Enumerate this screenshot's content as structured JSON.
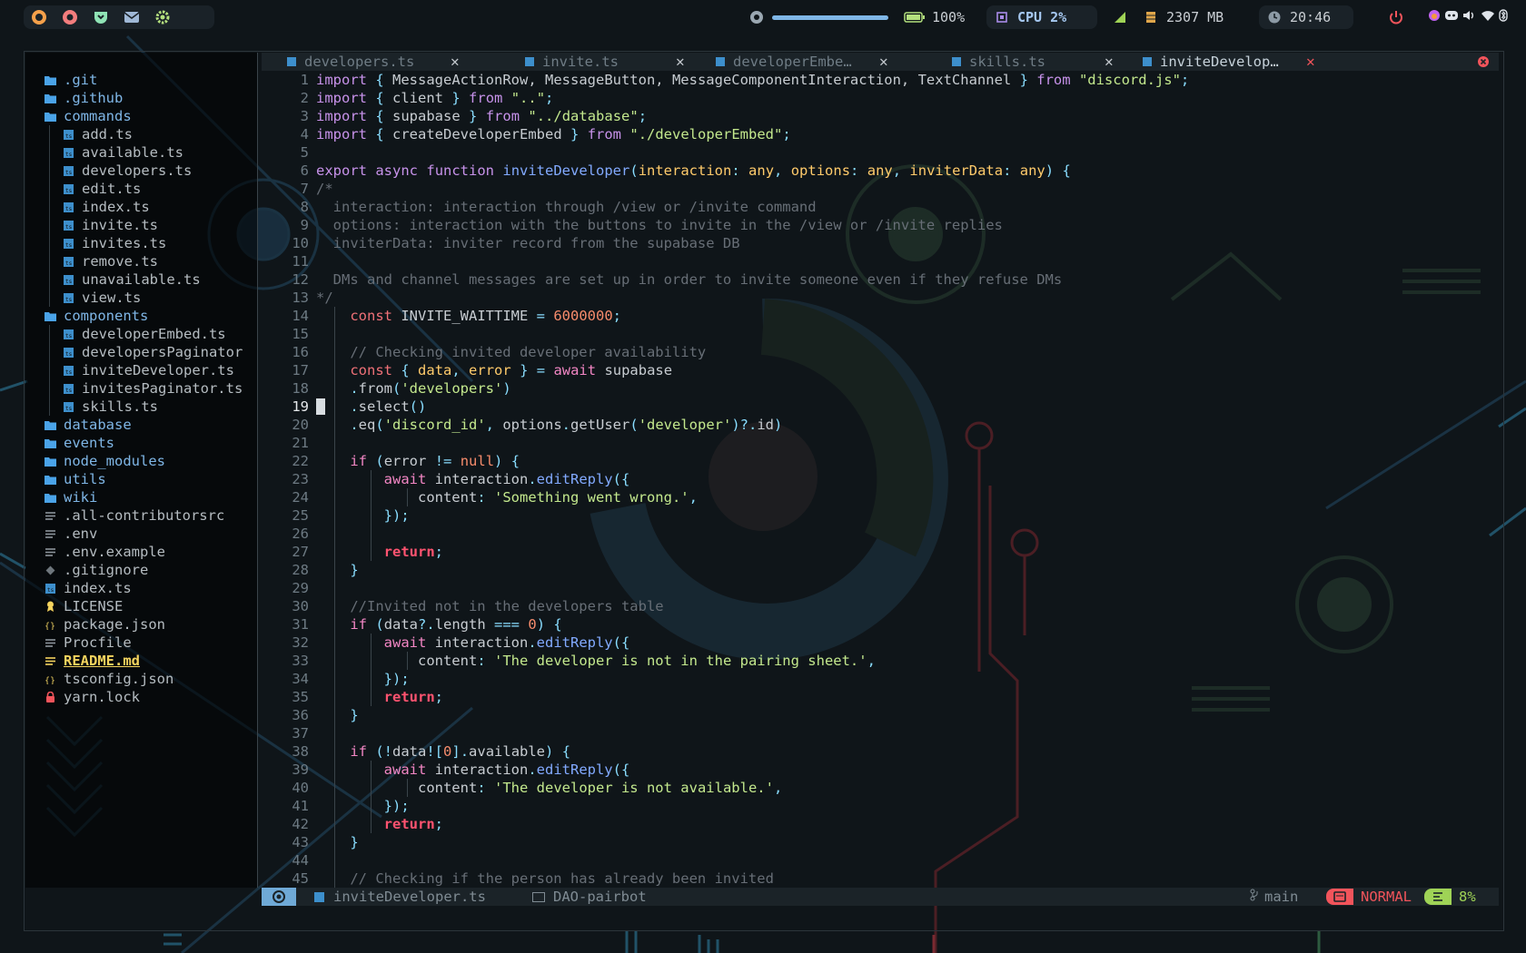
{
  "topbar": {
    "volume": "100%",
    "battery": "100%",
    "cpu": "CPU 2%",
    "memory": "2307 MB",
    "clock": "20:46",
    "volume_level": 1.0,
    "app_icons": [
      "firefox-icon",
      "chrome-icon",
      "pocket-icon",
      "mail-icon",
      "settings-icon"
    ],
    "tray_icons": [
      "power-icon",
      "flame-icon",
      "discord-icon",
      "speaker-icon",
      "wifi-icon",
      "bluetooth-icon"
    ]
  },
  "sidebar": {
    "items": [
      {
        "label": ".git",
        "type": "folder",
        "depth": 0
      },
      {
        "label": ".github",
        "type": "folder",
        "depth": 0
      },
      {
        "label": "commands",
        "type": "folder-open",
        "depth": 0
      },
      {
        "label": "add.ts",
        "type": "ts",
        "depth": 1
      },
      {
        "label": "available.ts",
        "type": "ts",
        "depth": 1
      },
      {
        "label": "developers.ts",
        "type": "ts",
        "depth": 1
      },
      {
        "label": "edit.ts",
        "type": "ts",
        "depth": 1
      },
      {
        "label": "index.ts",
        "type": "ts",
        "depth": 1
      },
      {
        "label": "invite.ts",
        "type": "ts",
        "depth": 1
      },
      {
        "label": "invites.ts",
        "type": "ts",
        "depth": 1
      },
      {
        "label": "remove.ts",
        "type": "ts",
        "depth": 1
      },
      {
        "label": "unavailable.ts",
        "type": "ts",
        "depth": 1
      },
      {
        "label": "view.ts",
        "type": "ts",
        "depth": 1
      },
      {
        "label": "components",
        "type": "folder-open",
        "depth": 0
      },
      {
        "label": "developerEmbed.ts",
        "type": "ts",
        "depth": 1
      },
      {
        "label": "developersPaginator",
        "type": "ts",
        "depth": 1
      },
      {
        "label": "inviteDeveloper.ts",
        "type": "ts",
        "depth": 1
      },
      {
        "label": "invitesPaginator.ts",
        "type": "ts",
        "depth": 1
      },
      {
        "label": "skills.ts",
        "type": "ts",
        "depth": 1
      },
      {
        "label": "database",
        "type": "folder",
        "depth": 0
      },
      {
        "label": "events",
        "type": "folder",
        "depth": 0
      },
      {
        "label": "node_modules",
        "type": "folder",
        "depth": 0
      },
      {
        "label": "utils",
        "type": "folder",
        "depth": 0
      },
      {
        "label": "wiki",
        "type": "folder",
        "depth": 0
      },
      {
        "label": ".all-contributorsrc",
        "type": "text",
        "depth": 0
      },
      {
        "label": ".env",
        "type": "text",
        "depth": 0
      },
      {
        "label": ".env.example",
        "type": "text",
        "depth": 0
      },
      {
        "label": ".gitignore",
        "type": "git",
        "depth": 0
      },
      {
        "label": "index.ts",
        "type": "ts",
        "depth": 0
      },
      {
        "label": "LICENSE",
        "type": "license",
        "depth": 0
      },
      {
        "label": "package.json",
        "type": "json",
        "depth": 0
      },
      {
        "label": "Procfile",
        "type": "text",
        "depth": 0
      },
      {
        "label": "README.md",
        "type": "readme",
        "depth": 0
      },
      {
        "label": "tsconfig.json",
        "type": "json",
        "depth": 0
      },
      {
        "label": "yarn.lock",
        "type": "lock",
        "depth": 0
      }
    ]
  },
  "tabs": [
    {
      "label": "developers.ts",
      "active": false
    },
    {
      "label": "invite.ts",
      "active": false
    },
    {
      "label": "developerEmbe…",
      "active": false
    },
    {
      "label": "skills.ts",
      "active": false
    },
    {
      "label": "inviteDevelop…",
      "active": true
    }
  ],
  "editor": {
    "current_line": 19,
    "lines": [
      [
        [
          "kw",
          "import"
        ],
        [
          "pl",
          " "
        ],
        [
          "p",
          "{"
        ],
        [
          "pl",
          " MessageActionRow, MessageButton, MessageComponentInteraction, TextChannel "
        ],
        [
          "p",
          "}"
        ],
        [
          "pl",
          " "
        ],
        [
          "kw",
          "from"
        ],
        [
          "pl",
          " "
        ],
        [
          "s",
          "\"discord.js\""
        ],
        [
          "p",
          ";"
        ]
      ],
      [
        [
          "kw",
          "import"
        ],
        [
          "pl",
          " "
        ],
        [
          "p",
          "{"
        ],
        [
          "pl",
          " client "
        ],
        [
          "p",
          "}"
        ],
        [
          "pl",
          " "
        ],
        [
          "kw",
          "from"
        ],
        [
          "pl",
          " "
        ],
        [
          "s",
          "\"..\""
        ],
        [
          "p",
          ";"
        ]
      ],
      [
        [
          "kw",
          "import"
        ],
        [
          "pl",
          " "
        ],
        [
          "p",
          "{"
        ],
        [
          "pl",
          " supabase "
        ],
        [
          "p",
          "}"
        ],
        [
          "pl",
          " "
        ],
        [
          "kw",
          "from"
        ],
        [
          "pl",
          " "
        ],
        [
          "s",
          "\"../database\""
        ],
        [
          "p",
          ";"
        ]
      ],
      [
        [
          "kw",
          "import"
        ],
        [
          "pl",
          " "
        ],
        [
          "p",
          "{"
        ],
        [
          "pl",
          " createDeveloperEmbed "
        ],
        [
          "p",
          "}"
        ],
        [
          "pl",
          " "
        ],
        [
          "kw",
          "from"
        ],
        [
          "pl",
          " "
        ],
        [
          "s",
          "\"./developerEmbed\""
        ],
        [
          "p",
          ";"
        ]
      ],
      [],
      [
        [
          "kw",
          "export"
        ],
        [
          "pl",
          " "
        ],
        [
          "kw",
          "async"
        ],
        [
          "pl",
          " "
        ],
        [
          "kw",
          "function"
        ],
        [
          "pl",
          " "
        ],
        [
          "fn",
          "inviteDeveloper"
        ],
        [
          "p",
          "("
        ],
        [
          "ty",
          "interaction"
        ],
        [
          "p",
          ":"
        ],
        [
          "pl",
          " "
        ],
        [
          "ty",
          "any"
        ],
        [
          "p",
          ","
        ],
        [
          "pl",
          " "
        ],
        [
          "ty",
          "options"
        ],
        [
          "p",
          ":"
        ],
        [
          "pl",
          " "
        ],
        [
          "ty",
          "any"
        ],
        [
          "p",
          ","
        ],
        [
          "pl",
          " "
        ],
        [
          "ty",
          "inviterData"
        ],
        [
          "p",
          ":"
        ],
        [
          "pl",
          " "
        ],
        [
          "ty",
          "any"
        ],
        [
          "p",
          ")"
        ],
        [
          "pl",
          " "
        ],
        [
          "p",
          "{"
        ]
      ],
      [
        [
          "c",
          "/*"
        ]
      ],
      [
        [
          "c",
          "  interaction: interaction through /view or /invite command"
        ]
      ],
      [
        [
          "c",
          "  options: interaction with the buttons to invite in the /view or /invite replies"
        ]
      ],
      [
        [
          "c",
          "  inviterData: inviter record from the supabase DB"
        ]
      ],
      [],
      [
        [
          "c",
          "  DMs and channel messages are set up in order to invite someone even if they refuse DMs"
        ]
      ],
      [
        [
          "c",
          "*/"
        ]
      ],
      [
        [
          "pl",
          "    "
        ],
        [
          "k",
          "const"
        ],
        [
          "pl",
          " INVITE_WAITTIME "
        ],
        [
          "p",
          "="
        ],
        [
          "pl",
          " "
        ],
        [
          "n",
          "6000000"
        ],
        [
          "p",
          ";"
        ]
      ],
      [],
      [
        [
          "pl",
          "    "
        ],
        [
          "c",
          "// Checking invited developer availability"
        ]
      ],
      [
        [
          "pl",
          "    "
        ],
        [
          "k",
          "const"
        ],
        [
          "pl",
          " "
        ],
        [
          "p",
          "{"
        ],
        [
          "pl",
          " "
        ],
        [
          "ty",
          "data"
        ],
        [
          "p",
          ","
        ],
        [
          "pl",
          " "
        ],
        [
          "ty",
          "error"
        ],
        [
          "pl",
          " "
        ],
        [
          "p",
          "}"
        ],
        [
          "pl",
          " "
        ],
        [
          "p",
          "="
        ],
        [
          "pl",
          " "
        ],
        [
          "kp",
          "await"
        ],
        [
          "pl",
          " supabase"
        ]
      ],
      [
        [
          "pl",
          "    "
        ],
        [
          "p",
          "."
        ],
        [
          "pl",
          "from"
        ],
        [
          "p",
          "("
        ],
        [
          "s",
          "'developers'"
        ],
        [
          "p",
          ")"
        ]
      ],
      [
        [
          "pl",
          "    "
        ],
        [
          "p",
          "."
        ],
        [
          "pl",
          "select"
        ],
        [
          "p",
          "()"
        ]
      ],
      [
        [
          "pl",
          "    "
        ],
        [
          "p",
          "."
        ],
        [
          "pl",
          "eq"
        ],
        [
          "p",
          "("
        ],
        [
          "s",
          "'discord_id'"
        ],
        [
          "p",
          ","
        ],
        [
          "pl",
          " options"
        ],
        [
          "p",
          "."
        ],
        [
          "pl",
          "getUser"
        ],
        [
          "p",
          "("
        ],
        [
          "s",
          "'developer'"
        ],
        [
          "p",
          ")?."
        ],
        [
          "pl",
          "id"
        ],
        [
          "p",
          ")"
        ]
      ],
      [],
      [
        [
          "pl",
          "    "
        ],
        [
          "kp",
          "if"
        ],
        [
          "pl",
          " "
        ],
        [
          "p",
          "("
        ],
        [
          "pl",
          "error "
        ],
        [
          "p",
          "!="
        ],
        [
          "pl",
          " "
        ],
        [
          "n",
          "null"
        ],
        [
          "p",
          ")"
        ],
        [
          "pl",
          " "
        ],
        [
          "p",
          "{"
        ]
      ],
      [
        [
          "pl",
          "        "
        ],
        [
          "kp",
          "await"
        ],
        [
          "pl",
          " interaction"
        ],
        [
          "p",
          "."
        ],
        [
          "fn",
          "editReply"
        ],
        [
          "p",
          "({"
        ]
      ],
      [
        [
          "pl",
          "            "
        ],
        [
          "pl",
          "content"
        ],
        [
          "p",
          ":"
        ],
        [
          "pl",
          " "
        ],
        [
          "s",
          "'Something went wrong.'"
        ],
        [
          "p",
          ","
        ]
      ],
      [
        [
          "pl",
          "        "
        ],
        [
          "p",
          "});"
        ]
      ],
      [],
      [
        [
          "pl",
          "        "
        ],
        [
          "r",
          "return"
        ],
        [
          "p",
          ";"
        ]
      ],
      [
        [
          "pl",
          "    "
        ],
        [
          "p",
          "}"
        ]
      ],
      [],
      [
        [
          "pl",
          "    "
        ],
        [
          "c",
          "//Invited not in the developers table"
        ]
      ],
      [
        [
          "pl",
          "    "
        ],
        [
          "kp",
          "if"
        ],
        [
          "pl",
          " "
        ],
        [
          "p",
          "("
        ],
        [
          "pl",
          "data"
        ],
        [
          "p",
          "?."
        ],
        [
          "pl",
          "length "
        ],
        [
          "p",
          "==="
        ],
        [
          "pl",
          " "
        ],
        [
          "n",
          "0"
        ],
        [
          "p",
          ")"
        ],
        [
          "pl",
          " "
        ],
        [
          "p",
          "{"
        ]
      ],
      [
        [
          "pl",
          "        "
        ],
        [
          "kp",
          "await"
        ],
        [
          "pl",
          " interaction"
        ],
        [
          "p",
          "."
        ],
        [
          "fn",
          "editReply"
        ],
        [
          "p",
          "({"
        ]
      ],
      [
        [
          "pl",
          "            "
        ],
        [
          "pl",
          "content"
        ],
        [
          "p",
          ":"
        ],
        [
          "pl",
          " "
        ],
        [
          "s",
          "'The developer is not in the pairing sheet.'"
        ],
        [
          "p",
          ","
        ]
      ],
      [
        [
          "pl",
          "        "
        ],
        [
          "p",
          "});"
        ]
      ],
      [
        [
          "pl",
          "        "
        ],
        [
          "r",
          "return"
        ],
        [
          "p",
          ";"
        ]
      ],
      [
        [
          "pl",
          "    "
        ],
        [
          "p",
          "}"
        ]
      ],
      [],
      [
        [
          "pl",
          "    "
        ],
        [
          "kp",
          "if"
        ],
        [
          "pl",
          " "
        ],
        [
          "p",
          "(!"
        ],
        [
          "pl",
          "data"
        ],
        [
          "p",
          "!["
        ],
        [
          "n",
          "0"
        ],
        [
          "p",
          "]."
        ],
        [
          "pl",
          "available"
        ],
        [
          "p",
          ")"
        ],
        [
          "pl",
          " "
        ],
        [
          "p",
          "{"
        ]
      ],
      [
        [
          "pl",
          "        "
        ],
        [
          "kp",
          "await"
        ],
        [
          "pl",
          " interaction"
        ],
        [
          "p",
          "."
        ],
        [
          "fn",
          "editReply"
        ],
        [
          "p",
          "({"
        ]
      ],
      [
        [
          "pl",
          "            "
        ],
        [
          "pl",
          "content"
        ],
        [
          "p",
          ":"
        ],
        [
          "pl",
          " "
        ],
        [
          "s",
          "'The developer is not available.'"
        ],
        [
          "p",
          ","
        ]
      ],
      [
        [
          "pl",
          "        "
        ],
        [
          "p",
          "});"
        ]
      ],
      [
        [
          "pl",
          "        "
        ],
        [
          "r",
          "return"
        ],
        [
          "p",
          ";"
        ]
      ],
      [
        [
          "pl",
          "    "
        ],
        [
          "p",
          "}"
        ]
      ],
      [],
      [
        [
          "pl",
          "    "
        ],
        [
          "c",
          "// Checking if the person has already been invited"
        ]
      ]
    ]
  },
  "statusbar": {
    "filename": "inviteDeveloper.ts",
    "project": "DAO-pairbot",
    "branch": "main",
    "mode": "NORMAL",
    "percent": "8%"
  },
  "colors": {
    "accent_blue": "#7fb6e6",
    "mode_red": "#f2545b",
    "percent_green": "#9fd356",
    "readme_yellow": "#f4d35e"
  }
}
